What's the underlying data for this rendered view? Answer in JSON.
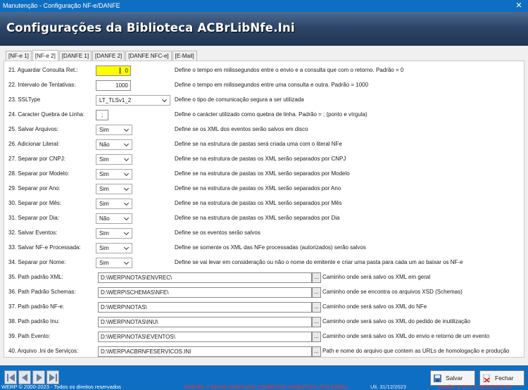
{
  "window": {
    "title": "Manutenção - Configuração NF-e/DANFE",
    "close_glyph": "✕"
  },
  "header": {
    "title": "Configurações da Biblioteca ACBrLibNfe.Ini"
  },
  "tabs": [
    {
      "label": "[NF-e 1]"
    },
    {
      "label": "[NF-e 2]"
    },
    {
      "label": "[DANFE 1]"
    },
    {
      "label": "[DANFE 2]"
    },
    {
      "label": "[DANFE NFC-e]"
    },
    {
      "label": "[E-Mail]"
    }
  ],
  "settings": {
    "aguardar": {
      "label": "21. Aguardar Consulta Ret.:",
      "value": "0",
      "desc": "Define o tempo em milissegundos entre o envio e a consulta que com o retorno. Padrão = 0"
    },
    "intervalo": {
      "label": "22. Intervalo de Tentativas:",
      "value": "1000",
      "desc": "Define o tempo em milissegundos entre uma consulta e outra. Padrão = 1000"
    },
    "ssl": {
      "label": "23. SSLType",
      "value": "LT_TLSv1_2",
      "desc": "Define o tipo de comunicação segura a ser utilizada"
    },
    "quebra": {
      "label": "24. Caracter Quebra de Linha:",
      "value": ";",
      "desc": "Define o carácter utilizado como quebra de linha. Padrão = ; (ponto e vírgula)"
    },
    "salvar_arquivos": {
      "label": "25. Salvar Arquivos:",
      "value": "Sim",
      "desc": "Define se os XML dos eventos serão salvos em disco"
    },
    "adicionar_literal": {
      "label": "26. Adicionar Literal:",
      "value": "Não",
      "desc": "Define se na estrutura de pastas será criada uma com o literal NFe"
    },
    "sep_cnpj": {
      "label": "27. Separar por CNPJ:",
      "value": "Sim",
      "desc": "Define se na estrutura de pastas os XML serão separados por CNPJ"
    },
    "sep_modelo": {
      "label": "28. Separar por Modelo:",
      "value": "Sim",
      "desc": "Define se na estrutura de pastas os XML serão separados por Modelo"
    },
    "sep_ano": {
      "label": "29. Separar por Ano:",
      "value": "Sim",
      "desc": "Define se na estrutura de pastas os XML serão separados por Ano"
    },
    "sep_mes": {
      "label": "30. Separar por Mês:",
      "value": "Sim",
      "desc": "Define se na estrutura de pastas os XML serão separados por Mês"
    },
    "sep_dia": {
      "label": "31. Separar por Dia:",
      "value": "Não",
      "desc": "Define se na estrutura de pastas os XML serão separados por Dia"
    },
    "salvar_eventos": {
      "label": "32. Salvar Eventos:",
      "value": "Sim",
      "desc": "Define se os eventos serão salvos"
    },
    "salvar_processada": {
      "label": "33. Salvar NF-e Processada:",
      "value": "Sim",
      "desc": "Define se somente os XML das NFe processadas (autorizados) serão salvos"
    },
    "sep_nome": {
      "label": "34. Separar por Nome:",
      "value": "Sim",
      "desc": "Define se vai levar em consideração ou não o nome do emitente e criar uma pasta para cada um ao baixar os NF-e"
    },
    "path_xml": {
      "label": "35. Path padrão XML:",
      "value": "D:\\WERP\\NOTAS\\ENVREC\\",
      "desc": "Caminho onde será salvo os XML em geral"
    },
    "path_schemas": {
      "label": "36. Path Padrão Schemas:",
      "value": "D:\\WERP\\SCHEMAS\\NFE\\",
      "desc": "Caminho onde se encontra os arquivos XSD (Schemas)"
    },
    "path_nfe": {
      "label": "37. Path padrão NF-e:",
      "value": "D:\\WERP\\NOTAS\\",
      "desc": "Caminho onde será salvo os XML do NFe"
    },
    "path_inu": {
      "label": "38. Path padrão Inu:",
      "value": "D:\\WERP\\NOTAS\\INU\\",
      "desc": "Caminho onde será salvo os XML do pedido de inutilização"
    },
    "path_evento": {
      "label": "39. Path Evento:",
      "value": "D:\\WERP\\NOTAS\\EVENTOS\\",
      "desc": "Caminho onde será salvo os XML do envio e retorno de um evento"
    },
    "path_servicos": {
      "label": "40. Arquivo .Ini de Serviços:",
      "value": "D:\\WERP\\ACBRNFESERVICOS.INI",
      "desc": "Path e nome do arquivo que contem as URLs de homologação e produção"
    }
  },
  "browse_glyph": "...",
  "footer": {
    "salvar": "Salvar",
    "fechar": "Fechar",
    "copyright": "WERP © 2000-2023 - Todos os direitos reservados",
    "company": "RAFAEL Y EDHIS SANTIAGO COMÉRCIO VAREJISTA LTDA EIRELI",
    "last": "Ult. 31/12/2023",
    "version": "Versão: 2.0.71.1 09/02/2023  05"
  },
  "colors": {
    "title_bar": "#0e6fc2",
    "header_dark": "#1f3553",
    "highlight_field": "#ffff00",
    "status_red": "#ff2a2a"
  }
}
